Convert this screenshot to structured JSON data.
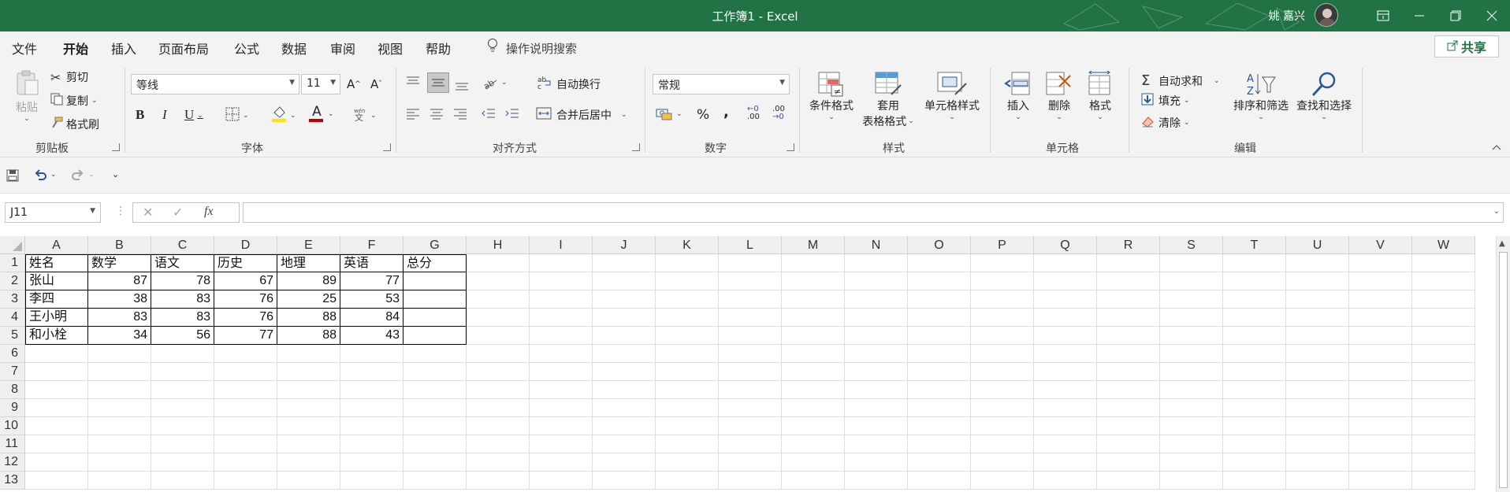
{
  "titlebar": {
    "title": "工作簿1  -  Excel",
    "user": "姚 嘉兴",
    "accent": "#217346"
  },
  "menu": {
    "tabs": [
      {
        "label": "文件"
      },
      {
        "label": "开始"
      },
      {
        "label": "插入"
      },
      {
        "label": "页面布局"
      },
      {
        "label": "公式"
      },
      {
        "label": "数据"
      },
      {
        "label": "审阅"
      },
      {
        "label": "视图"
      },
      {
        "label": "帮助"
      }
    ],
    "active_tab": "开始",
    "tell_me": "操作说明搜索",
    "share": "共享"
  },
  "ribbon": {
    "clipboard": {
      "paste": "粘贴",
      "cut": "剪切",
      "copy": "复制",
      "format_painter": "格式刷",
      "label": "剪贴板"
    },
    "font": {
      "font_name": "等线",
      "font_size": "11",
      "bold": "B",
      "italic": "I",
      "underline": "U",
      "grow": "A",
      "shrink": "A",
      "font_color": "A",
      "label": "字体"
    },
    "alignment": {
      "wrap": "自动换行",
      "merge": "合并后居中",
      "label": "对齐方式"
    },
    "number": {
      "format": "常规",
      "percent": "%",
      "comma": ",",
      "inc_decimal": ".00",
      "dec_decimal": ".00",
      "label": "数字"
    },
    "styles": {
      "conditional": "条件格式",
      "table_line1": "套用",
      "table_line2": "表格格式",
      "cell_styles": "单元格样式",
      "label": "样式"
    },
    "cells": {
      "insert": "插入",
      "delete": "删除",
      "format": "格式",
      "label": "单元格"
    },
    "editing": {
      "autosum": "自动求和",
      "fill": "填充",
      "clear": "清除",
      "sort": "排序和筛选",
      "find": "查找和选择",
      "label": "编辑"
    }
  },
  "formula_bar": {
    "name_box": "J11",
    "fx": "fx",
    "cancel": "✕",
    "enter": "✓",
    "formula": ""
  },
  "columns": [
    "A",
    "B",
    "C",
    "D",
    "E",
    "F",
    "G",
    "H",
    "I",
    "J",
    "K",
    "L",
    "M",
    "N",
    "O",
    "P",
    "Q",
    "R",
    "S",
    "T",
    "U",
    "V",
    "W"
  ],
  "rows": [
    "1",
    "2",
    "3",
    "4",
    "5",
    "6",
    "7",
    "8",
    "9",
    "10",
    "11",
    "12",
    "13"
  ],
  "sheet": {
    "header": [
      "姓名",
      "数学",
      "语文",
      "历史",
      "地理",
      "英语",
      "总分"
    ],
    "data": [
      [
        "张山",
        "87",
        "78",
        "67",
        "89",
        "77",
        ""
      ],
      [
        "李四",
        "38",
        "83",
        "76",
        "25",
        "53",
        ""
      ],
      [
        "王小明",
        "83",
        "83",
        "76",
        "88",
        "84",
        ""
      ],
      [
        "和小栓",
        "34",
        "56",
        "77",
        "88",
        "43",
        ""
      ]
    ]
  }
}
